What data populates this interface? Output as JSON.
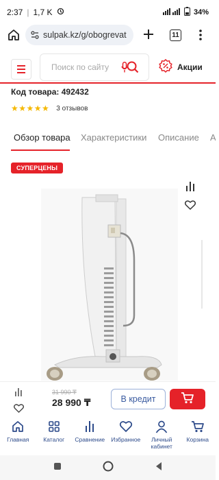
{
  "status_bar": {
    "time": "2:37",
    "network_speed": "1,7 K",
    "battery": "34"
  },
  "browser": {
    "url": "sulpak.kz/g/obogrevat",
    "tab_count": "11"
  },
  "header": {
    "search_placeholder": "Поиск по сайту",
    "promo_label": "Акции"
  },
  "product": {
    "code_label": "Код товара: 492432",
    "rating_stars": 5,
    "reviews_label": "3 отзывов",
    "badge": "СУПЕРЦЕНЫ"
  },
  "tabs": [
    {
      "label": "Обзор товара",
      "active": true
    },
    {
      "label": "Характеристики",
      "active": false
    },
    {
      "label": "Описание",
      "active": false
    },
    {
      "label": "А",
      "active": false
    }
  ],
  "purchase": {
    "old_price": "31 990 ₸",
    "price": "28 990 ₸",
    "credit_label": "В кредит"
  },
  "bottom_nav": [
    {
      "label": "Главная",
      "icon": "home-icon"
    },
    {
      "label": "Каталог",
      "icon": "catalog-icon"
    },
    {
      "label": "Сравнение",
      "icon": "compare-icon"
    },
    {
      "label": "Избранное",
      "icon": "heart-icon"
    },
    {
      "label": "Личный кабинет",
      "icon": "user-icon"
    },
    {
      "label": "Корзина",
      "icon": "cart-icon"
    }
  ],
  "colors": {
    "brand_red": "#e52229",
    "nav_blue": "#2c4a8a",
    "star": "#f5b800"
  }
}
